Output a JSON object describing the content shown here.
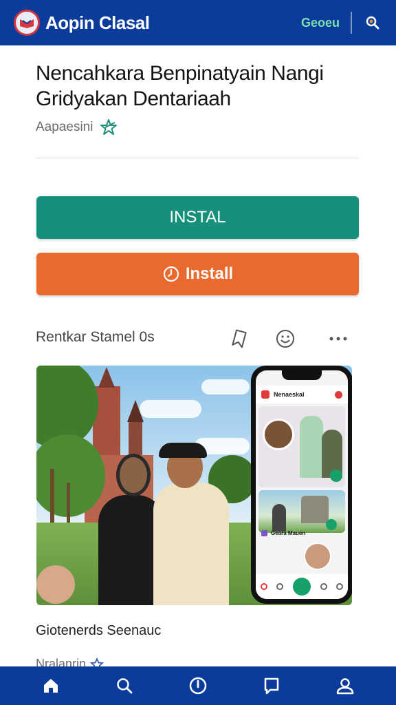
{
  "header": {
    "app_title": "Aopin Clasal",
    "link_label": "Geoeu",
    "logo_icon": "app-logo-icon",
    "search_icon": "search-icon"
  },
  "listing": {
    "title_line1": "Nencahkara Benpinatyain Nangi",
    "title_line2": "Gridyakan Dentariaah",
    "developer": "Aapaesini",
    "developer_badge_icon": "star-icon"
  },
  "buttons": {
    "install_primary": "INSTAL",
    "install_secondary": "Install",
    "install_secondary_icon": "clock-icon"
  },
  "section": {
    "title": "Rentkar Stamel 0s",
    "actions": [
      "bookmark-icon",
      "smile-icon",
      "more-icon"
    ]
  },
  "screenshot": {
    "phone_app_title": "Nenaeskal",
    "phone_caption": "Geara Mauen"
  },
  "caption": {
    "title": "Giotenerds Seenauc",
    "subtitle": "Nralanrin"
  },
  "bottom_nav": {
    "items": [
      "home-icon",
      "search-icon",
      "info-icon",
      "bookmark-icon",
      "profile-icon"
    ]
  },
  "colors": {
    "brand_blue": "#0b3c9c",
    "install_teal": "#16907a",
    "install_orange": "#e86a2f",
    "header_link": "#7ee0b0"
  }
}
